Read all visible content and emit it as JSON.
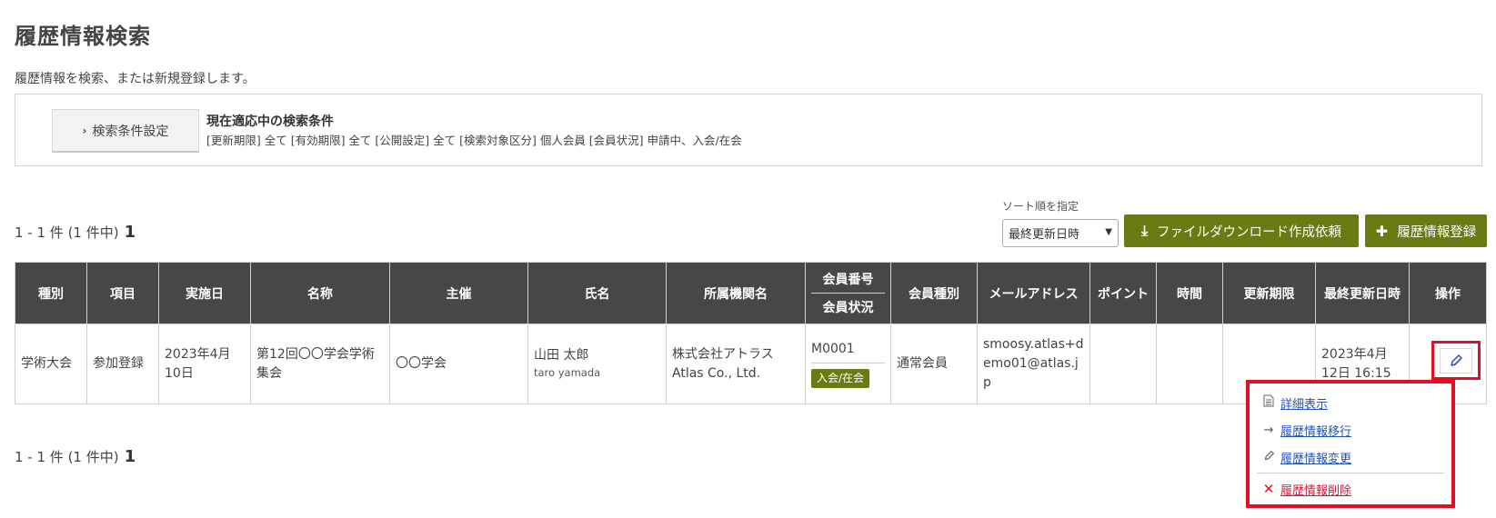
{
  "page": {
    "title": "履歴情報検索",
    "description": "履歴情報を検索、または新規登録します。"
  },
  "search": {
    "button_label": "検索条件設定",
    "conditions_title": "現在適応中の検索条件",
    "conditions_text": "[更新期限] 全て  [有効期限] 全て  [公開設定] 全て  [検索対象区分] 個人会員  [会員状況] 申請中、入会/在会"
  },
  "results": {
    "count_text": "1 - 1 件 (1 件中)",
    "page_number": "1"
  },
  "sort": {
    "label": "ソート順を指定",
    "selected": "最終更新日時"
  },
  "actions": {
    "download_label": "ファイルダウンロード作成依頼",
    "register_label": "履歴情報登録"
  },
  "table": {
    "headers": {
      "type": "種別",
      "item": "項目",
      "date": "実施日",
      "name": "名称",
      "host": "主催",
      "person": "氏名",
      "org": "所属機関名",
      "member_no": "会員番号",
      "member_status": "会員状況",
      "member_type": "会員種別",
      "email": "メールアドレス",
      "points": "ポイント",
      "time": "時間",
      "renewal": "更新期限",
      "updated": "最終更新日時",
      "ops": "操作"
    },
    "rows": [
      {
        "type": "学術大会",
        "item": "参加登録",
        "date": "2023年4月10日",
        "name": "第12回〇〇学会学術集会",
        "host": "〇〇学会",
        "person_name": "山田 太郎",
        "person_romaji": "taro yamada",
        "org_ja": "株式会社アトラス",
        "org_en": "Atlas Co., Ltd.",
        "member_no": "M0001",
        "member_status": "入会/在会",
        "member_type": "通常会員",
        "email": "smoosy.atlas+demo01@atlas.jp",
        "points": "",
        "time": "",
        "renewal": "",
        "updated": "2023年4月12日 16:15"
      }
    ]
  },
  "menu": {
    "detail": "詳細表示",
    "migrate": "履歴情報移行",
    "edit": "履歴情報変更",
    "delete": "履歴情報削除"
  },
  "colors": {
    "accent_olive": "#6b7a12",
    "header_dark": "#474747",
    "highlight_red": "#e30e23",
    "link_blue": "#2352b6"
  }
}
